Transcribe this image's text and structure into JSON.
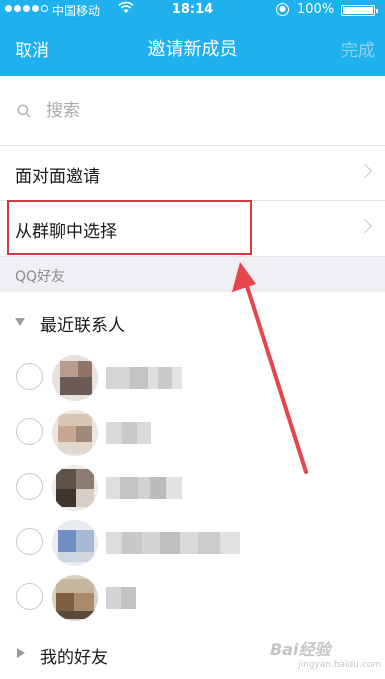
{
  "status_bar": {
    "carrier": "中国移动",
    "wifi_icon": "wifi-icon",
    "time": "18:14",
    "battery": "100%"
  },
  "nav": {
    "cancel": "取消",
    "title": "邀请新成员",
    "done": "完成"
  },
  "search": {
    "placeholder": "搜索"
  },
  "menu": {
    "face_to_face": "面对面邀请",
    "from_group": "从群聊中选择"
  },
  "section": {
    "qq_friends": "QQ好友"
  },
  "groups": {
    "recent": "最近联系人",
    "my_friends": "我的好友"
  },
  "contacts": [
    {
      "name": "",
      "avatar_icon": "blurred-avatar"
    },
    {
      "name": "",
      "avatar_icon": "blurred-avatar"
    },
    {
      "name": "",
      "avatar_icon": "blurred-avatar"
    },
    {
      "name": "",
      "avatar_icon": "blurred-avatar"
    },
    {
      "name": "",
      "avatar_icon": "blurred-avatar"
    }
  ],
  "watermark": {
    "brand": "Bai经验",
    "url": "jingyan.baidu.com"
  },
  "colors": {
    "header": "#1fb0ee",
    "highlight": "#d9363e",
    "arrow": "#e5454b"
  }
}
